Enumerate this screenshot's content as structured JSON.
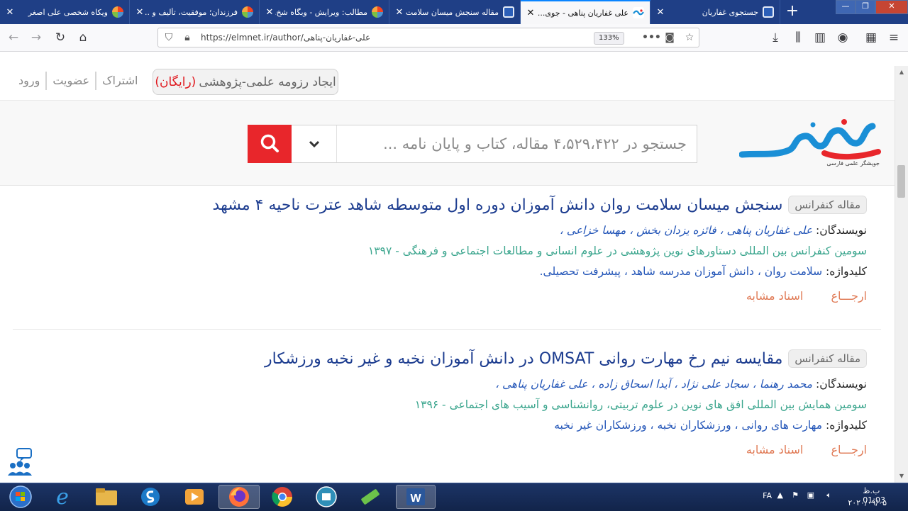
{
  "tabs": [
    {
      "title": "ویکاه شخصی علی اصغر"
    },
    {
      "title": "فرزندان؛ موفقیت، تألیف و ..."
    },
    {
      "title": "مطالب: ویرایش - وبگاه شخ..."
    },
    {
      "title": "مقاله سنجش میسان سلامت"
    },
    {
      "title": "علی غفاریان پناهی - جوی..."
    },
    {
      "title": "جستجوی غفاریان"
    }
  ],
  "url": "https://elmnet.ir/author/علی-غفاریان-پناهی",
  "zoom": "133%",
  "topbar": {
    "resume_label": "ایجاد رزومه علمی-پژوهشی",
    "resume_free": "(رایگان)",
    "links": [
      "اشتراک",
      "عضویت",
      "ورود"
    ]
  },
  "logo": {
    "text": "علم‌نت",
    "tagline": "جویشگر علمی فارسی"
  },
  "search": {
    "placeholder": "جستجو در ۴،۵۲۹،۴۲۲ مقاله، کتاب و پایان نامه ..."
  },
  "results": [
    {
      "badge": "مقاله کنفرانس",
      "title": "سنجش میسان سلامت روان دانش آموزان دوره اول متوسطه شاهد عترت ناحیه ۴ مشهد",
      "authors_label": "نویسندگان:",
      "authors": "علی غفاریان پناهی ، فائزه یزدان بخش ، مهسا خزاعی ،",
      "venue": "سومین کنفرانس بین المللی دستاورهای نوین پژوهشی در علوم انسانی و مطالعات اجتماعی و فرهنگی - ۱۳۹۷",
      "keywords_label": "کلیدواژه:",
      "keywords": "سلامت روان ، دانش آموزان مدرسه شاهد ، پیشرفت تحصیلی.",
      "action_cite": "ارجـــاع",
      "action_similar": "اسناد مشابه"
    },
    {
      "badge": "مقاله کنفرانس",
      "title": "مقایسه نیم رخ مهارت روانی OMSAT در دانش آموزان نخبه و غیر نخبه ورزشکار",
      "authors_label": "نویسندگان:",
      "authors": "محمد رهنما ، سجاد علی نژاد ، آیدا اسحاق زاده ، علی غفاریان پناهی ،",
      "venue": "سومین همایش بین المللی افق های نوین در علوم تربیتی، روانشناسی و آسیب های اجتماعی - ۱۳۹۶",
      "keywords_label": "کلیدواژه:",
      "keywords": "مهارت های روانی ، ورزشکاران نخبه ، ورزشکاران غیر نخبه",
      "action_cite": "ارجـــاع",
      "action_similar": "اسناد مشابه"
    }
  ],
  "taskbar": {
    "lang": "FA",
    "time": "ب.ظ 01:03",
    "date": "۲۰۲۰/۰۹/۰۵"
  },
  "colors": {
    "brand_blue": "#1a8fd6",
    "brand_red": "#e8262b",
    "tab_strip": "#1f3f86",
    "title_link": "#1c3c8f",
    "venue_green": "#3aa58d"
  }
}
